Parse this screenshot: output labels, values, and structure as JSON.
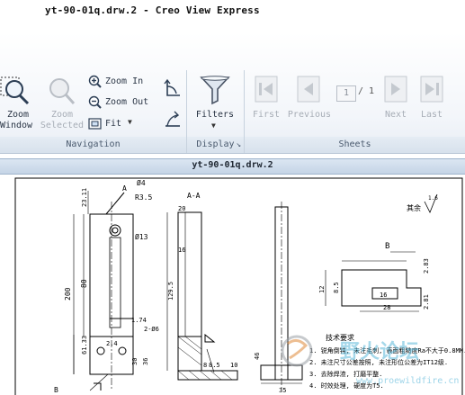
{
  "window": {
    "title": "yt-90-01q.drw.2 - Creo View Express"
  },
  "ribbon": {
    "navigation": {
      "group_label": "Navigation",
      "zoom_window": {
        "line1": "Zoom",
        "line2": "Window"
      },
      "zoom_selected": {
        "line1": "Zoom",
        "line2": "Selected"
      },
      "zoom_in": "Zoom In",
      "zoom_out": "Zoom Out",
      "fit": "Fit"
    },
    "display": {
      "group_label": "Display",
      "filters": "Filters"
    },
    "sheets": {
      "group_label": "Sheets",
      "first": "First",
      "previous": "Previous",
      "page_current": "1",
      "page_total": "/ 1",
      "next": "Next",
      "last": "Last"
    }
  },
  "document": {
    "tab_title": "yt-90-01q.drw.2"
  },
  "drawing": {
    "section_label": "A-A",
    "label_a": "A",
    "label_b": "B",
    "label_b2": "B",
    "dims": {
      "d1": "23.11",
      "d2": "Ø4",
      "d3": "R3.5",
      "d4": "Ø13",
      "d5": "200",
      "d6": "80",
      "d7": "61.33",
      "d8": "1.74",
      "d9": "2-Ø6",
      "d10": "2.4",
      "d11": "30",
      "d12": "36",
      "d13": "20",
      "d14": "16",
      "d15": "129.5",
      "d16": "8",
      "d17": "8.5",
      "d18": "12",
      "d19": "16",
      "d20": "28",
      "d21": "2.83",
      "d22": "2.81",
      "d23": "35",
      "d24": "46",
      "d25": "8.5",
      "d26": "10"
    },
    "roughness_note": "其余",
    "roughness_value": "1.6",
    "tech_title": "技术要求",
    "tech_items": [
      "1. 锐角倒钝, 未注毛刺, 表面粗糙度Ra不大于0.8MM.",
      "2. 未注尺寸公差按照, 未注形位公差为IT12级.",
      "3. 去除焊渣, 打磨平整.",
      "4. 时效处理, 硬度为T5."
    ],
    "watermark_cn": "野火论坛",
    "watermark_en": "www.proewildfire.cn"
  }
}
